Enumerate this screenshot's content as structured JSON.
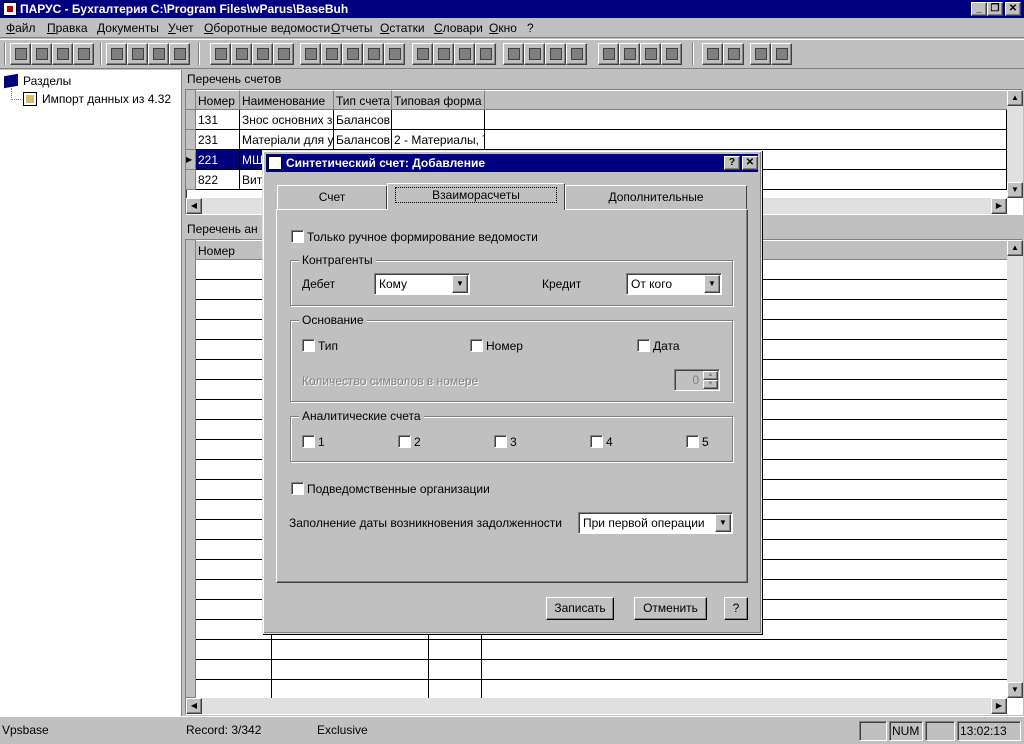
{
  "window": {
    "title": "ПАРУС - Бухгалтерия  C:\\Program Files\\wParus\\BaseBuh",
    "min": "_",
    "restore": "❐",
    "close": "✕"
  },
  "menu": [
    "Файл",
    "Правка",
    "Документы",
    "Учет",
    "Оборотные ведомости",
    "Отчеты",
    "Остатки",
    "Словари",
    "Окно",
    "?"
  ],
  "tree": {
    "root": "Разделы",
    "child": "Импорт данных из 4.32"
  },
  "accounts_pane": {
    "title": "Перечень счетов",
    "columns": [
      "Номер",
      "Наименование",
      "Тип счета",
      "Типовая форма"
    ],
    "rows": [
      [
        "131",
        "Знос основних з",
        "Балансов",
        ""
      ],
      [
        "231",
        "Матеріали для у",
        "Балансов",
        "2 - Материалы, Т"
      ],
      [
        "221",
        "МШ",
        "",
        ""
      ],
      [
        "822",
        "Вит",
        "",
        ""
      ]
    ]
  },
  "analytics_pane": {
    "title": "Перечень ан",
    "columns": [
      "Номер"
    ]
  },
  "status": {
    "db": "Vpsbase",
    "record": "Record: 3/342",
    "mode": "Exclusive",
    "num": "NUM",
    "time": "13:02:13"
  },
  "dialog": {
    "title": "Синтетический счет: Добавление",
    "help_btn": "?",
    "close_btn": "✕",
    "tabs": [
      "Счет",
      "Взаиморасчеты",
      "Дополнительные"
    ],
    "manual_only": "Только ручное формирование ведомости",
    "counterparties": {
      "title": "Контрагенты",
      "debit_label": "Дебет",
      "debit_value": "Кому",
      "credit_label": "Кредит",
      "credit_value": "От кого"
    },
    "basis": {
      "title": "Основание",
      "type": "Тип",
      "number": "Номер",
      "date": "Дата",
      "chars_label": "Количество символов в номере",
      "chars_value": "0"
    },
    "analytic": {
      "title": "Аналитические счета",
      "items": [
        "1",
        "2",
        "3",
        "4",
        "5"
      ]
    },
    "subordinate": "Подведомственные организации",
    "debt_date_label": "Заполнение даты возникновения задолженности",
    "debt_date_value": "При первой операции",
    "save": "Записать",
    "cancel": "Отменить",
    "help": "?"
  }
}
